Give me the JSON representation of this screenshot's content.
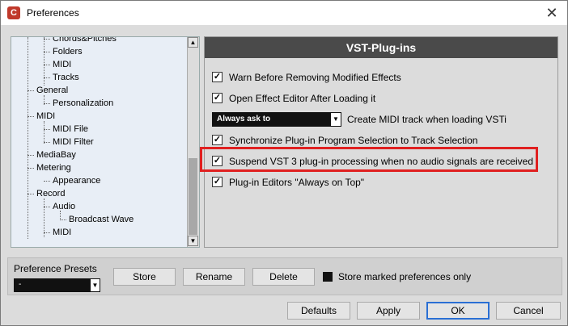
{
  "window": {
    "title": "Preferences",
    "close_glyph": "✕",
    "app_icon": "C"
  },
  "tree": {
    "items": [
      {
        "label": "Chords&Pitches",
        "level": 2
      },
      {
        "label": "Folders",
        "level": 2
      },
      {
        "label": "MIDI",
        "level": 2
      },
      {
        "label": "Tracks",
        "level": 2
      },
      {
        "label": "General",
        "level": 1
      },
      {
        "label": "Personalization",
        "level": 2
      },
      {
        "label": "MIDI",
        "level": 1
      },
      {
        "label": "MIDI File",
        "level": 2
      },
      {
        "label": "MIDI Filter",
        "level": 2
      },
      {
        "label": "MediaBay",
        "level": 1
      },
      {
        "label": "Metering",
        "level": 1
      },
      {
        "label": "Appearance",
        "level": 2
      },
      {
        "label": "Record",
        "level": 1
      },
      {
        "label": "Audio",
        "level": 2
      },
      {
        "label": "Broadcast Wave",
        "level": 3
      },
      {
        "label": "MIDI",
        "level": 2
      }
    ],
    "scroll_up": "▲",
    "scroll_down": "▼"
  },
  "panel": {
    "title": "VST-Plug-ins",
    "options": [
      {
        "label": "Warn Before Removing Modified Effects",
        "checked": true
      },
      {
        "label": "Open Effect Editor After Loading it",
        "checked": true
      },
      {
        "label": "Synchronize Plug-in Program Selection to Track Selection",
        "checked": true
      },
      {
        "label": "Suspend VST 3 plug-in processing when no audio signals are received",
        "checked": true
      },
      {
        "label": "Plug-in Editors \"Always on Top\"",
        "checked": true
      }
    ],
    "select": {
      "value": "Always ask to",
      "label": "Create MIDI track when loading VSTi",
      "arrow": "▼"
    },
    "check_glyph": "✓"
  },
  "presets": {
    "label": "Preference Presets",
    "select_value": "-",
    "arrow": "▼",
    "store": "Store",
    "rename": "Rename",
    "delete": "Delete",
    "store_marked": "Store marked preferences only"
  },
  "footer": {
    "defaults": "Defaults",
    "apply": "Apply",
    "ok": "OK",
    "cancel": "Cancel"
  },
  "colors": {
    "highlight": "#e02020",
    "header_bg": "#4a4a4a",
    "ok_border": "#2a6fd4"
  }
}
